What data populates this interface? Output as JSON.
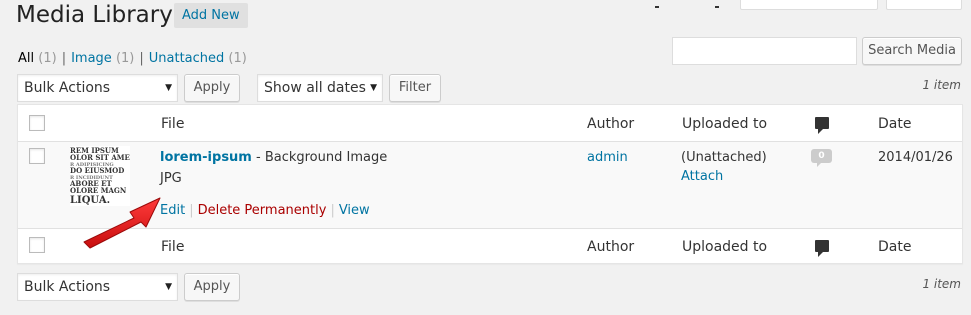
{
  "header": {
    "title": "Media Library",
    "add_new_label": "Add New"
  },
  "views": [
    {
      "label": "All",
      "count": "(1)",
      "current": true
    },
    {
      "label": "Image",
      "count": "(1)",
      "current": false
    },
    {
      "label": "Unattached",
      "count": "(1)",
      "current": false
    }
  ],
  "search": {
    "value": "",
    "button_label": "Search Media"
  },
  "tablenav_top": {
    "bulk_actions": "Bulk Actions",
    "apply_label": "Apply",
    "date_filter": "Show all dates",
    "filter_label": "Filter",
    "items_count": "1 item"
  },
  "tablenav_bottom": {
    "bulk_actions": "Bulk Actions",
    "apply_label": "Apply",
    "items_count": "1 item"
  },
  "columns": {
    "file": "File",
    "author": "Author",
    "uploaded_to": "Uploaded to",
    "comments_icon": "comment-bubble-icon",
    "date": "Date"
  },
  "rows": [
    {
      "thumbnail_text": [
        "REM IPSUM",
        "OLOR SIT AME",
        "R ADIPISICING",
        "DO EIUSMOD",
        "R INCIDIDUNT",
        "ABORE ET",
        "OLORE MAGN",
        "LIQUA."
      ],
      "title": "lorem-ipsum",
      "title_suffix": " - Background Image",
      "file_type": "JPG",
      "actions": {
        "edit": "Edit",
        "delete": "Delete Permanently",
        "view": "View"
      },
      "author": "admin",
      "uploaded_to": "(Unattached)",
      "attach_label": "Attach",
      "comments": "0",
      "date": "2014/01/26"
    }
  ],
  "colors": {
    "link": "#0074a2",
    "delete": "#aa0000",
    "arrow": "#e21b1b",
    "background": "#f1f1f1"
  }
}
